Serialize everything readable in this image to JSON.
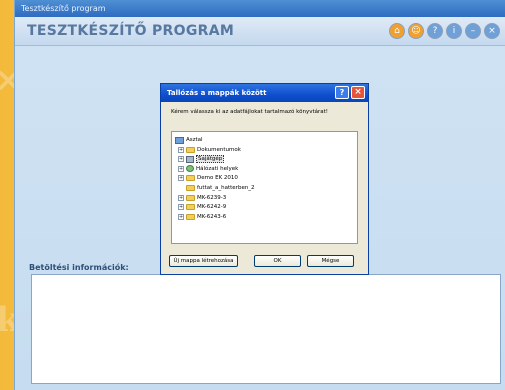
{
  "window": {
    "title": "Tesztkészítő program"
  },
  "app": {
    "title": "TESZTKÉSZÍTŐ PROGRAM"
  },
  "header_icons": [
    {
      "name": "home-icon",
      "color": "#f0a030"
    },
    {
      "name": "person-icon",
      "color": "#f0a030"
    },
    {
      "name": "help-icon",
      "color": "#6fa0d8"
    },
    {
      "name": "info-icon",
      "color": "#6fa0d8"
    },
    {
      "name": "minimize-icon",
      "color": "#6fa0d8"
    },
    {
      "name": "close-icon",
      "color": "#6fa0d8"
    }
  ],
  "info": {
    "label": "Betöltési információk:"
  },
  "dialog": {
    "title": "Tallózás a mappák között",
    "help": "?",
    "close": "×",
    "prompt": "Kérem válassza ki az adatfájlokat tartalmazó könyvtárat!",
    "tree": [
      {
        "label": "Asztal",
        "icon": "desktop-icon",
        "expander": "",
        "level": 0
      },
      {
        "label": "Dokumentumok",
        "icon": "folder-icon",
        "expander": "+",
        "level": 1
      },
      {
        "label": "Sajátgép",
        "icon": "computer-icon",
        "expander": "+",
        "level": 1,
        "selected": true
      },
      {
        "label": "Hálózati helyek",
        "icon": "network-icon",
        "expander": "+",
        "level": 1
      },
      {
        "label": "Demo EK 2010",
        "icon": "folder-icon",
        "expander": "+",
        "level": 1
      },
      {
        "label": "futtat_a_hatterben_2",
        "icon": "folder-icon",
        "expander": "",
        "level": 1
      },
      {
        "label": "MK-6239-3",
        "icon": "folder-icon",
        "expander": "+",
        "level": 1
      },
      {
        "label": "MK-6242-9",
        "icon": "folder-icon",
        "expander": "+",
        "level": 1
      },
      {
        "label": "MK-6243-6",
        "icon": "folder-icon",
        "expander": "+",
        "level": 1
      }
    ],
    "buttons": {
      "new_folder": "Új mappa létrehozása",
      "ok": "OK",
      "cancel": "Mégse"
    }
  }
}
